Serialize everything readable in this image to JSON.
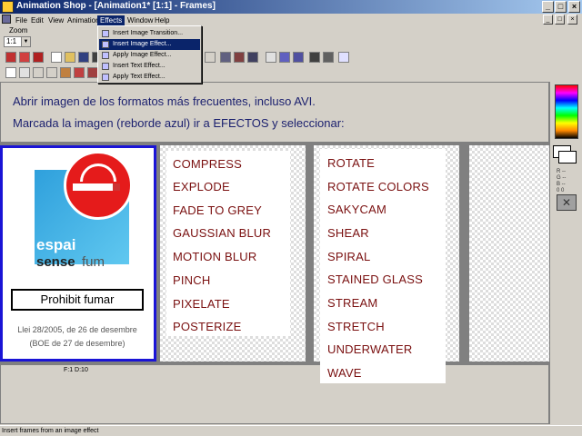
{
  "window": {
    "title": "Animation Shop - [Animation1* [1:1] - Frames]",
    "minimize": "_",
    "maximize": "□",
    "close": "×"
  },
  "menu": {
    "items": [
      "File",
      "Edit",
      "View",
      "Animation",
      "Effects",
      "Window",
      "Help"
    ],
    "active": "Effects"
  },
  "zoom": {
    "label": "Zoom",
    "value": "1:1"
  },
  "effects_menu": {
    "items": [
      "Insert Image Transition...",
      "Insert Image Effect...",
      "Apply Image Effect...",
      "Insert Text Effect...",
      "Apply Text Effect..."
    ],
    "selected_index": 1
  },
  "instructions": {
    "line1": "Abrir imagen de los formatos más frecuentes, incluso AVI.",
    "line2": "Marcada la imagen (reborde azul) ir a EFECTOS y seleccionar:"
  },
  "frame1": {
    "logo_text_1": "espai",
    "logo_text_2a": "sense",
    "logo_text_2b": "fum",
    "prohibit": "Prohibit fumar",
    "law_line1": "Llei 28/2005, de 26 de desembre",
    "law_line2": "(BOE de 27 de desembre)",
    "frame_label": "F:1  D:10"
  },
  "effects_list_1": [
    "COMPRESS",
    "EXPLODE",
    "FADE TO GREY",
    "GAUSSIAN BLUR",
    "MOTION BLUR",
    "PINCH",
    "PIXELATE",
    "POSTERIZE"
  ],
  "effects_list_2": [
    "ROTATE",
    "ROTATE COLORS",
    "SAKYCAM",
    "SHEAR",
    "SPIRAL",
    "STAINED GLASS",
    "STREAM",
    "STRETCH",
    "UNDERWATER",
    "WAVE"
  ],
  "statusbar": {
    "text": "Insert frames from an image effect"
  },
  "colors": {
    "title_gradient_start": "#0a246a",
    "effect_text": "#7a1010",
    "instruction_text": "#1a1f6e",
    "selection_border": "#1a14d6"
  }
}
